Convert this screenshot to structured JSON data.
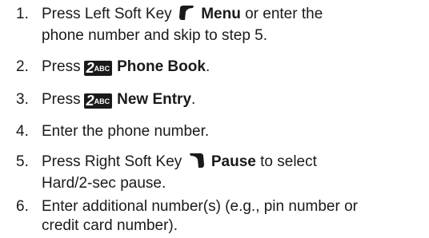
{
  "steps": [
    {
      "num": "1.",
      "before": "Press Left Soft Key",
      "icon": "left-soft-key-icon",
      "bold": "Menu",
      "after": "or enter the",
      "line2": "phone number and skip to step 5."
    },
    {
      "num": "2.",
      "before": "Press",
      "key_digit": "2",
      "key_letters": "ABC",
      "bold": "Phone Book",
      "after": "."
    },
    {
      "num": "3.",
      "before": "Press",
      "key_digit": "2",
      "key_letters": "ABC",
      "bold": "New Entry",
      "after": "."
    },
    {
      "num": "4.",
      "text": "Enter the phone number."
    },
    {
      "num": "5.",
      "before": "Press Right Soft Key",
      "icon": "right-soft-key-icon",
      "bold": "Pause",
      "after": "to select",
      "line2": "Hard/2-sec pause."
    },
    {
      "num": "6.",
      "line1": "Enter additional number(s) (e.g., pin number or",
      "line2": "credit card number)."
    }
  ]
}
